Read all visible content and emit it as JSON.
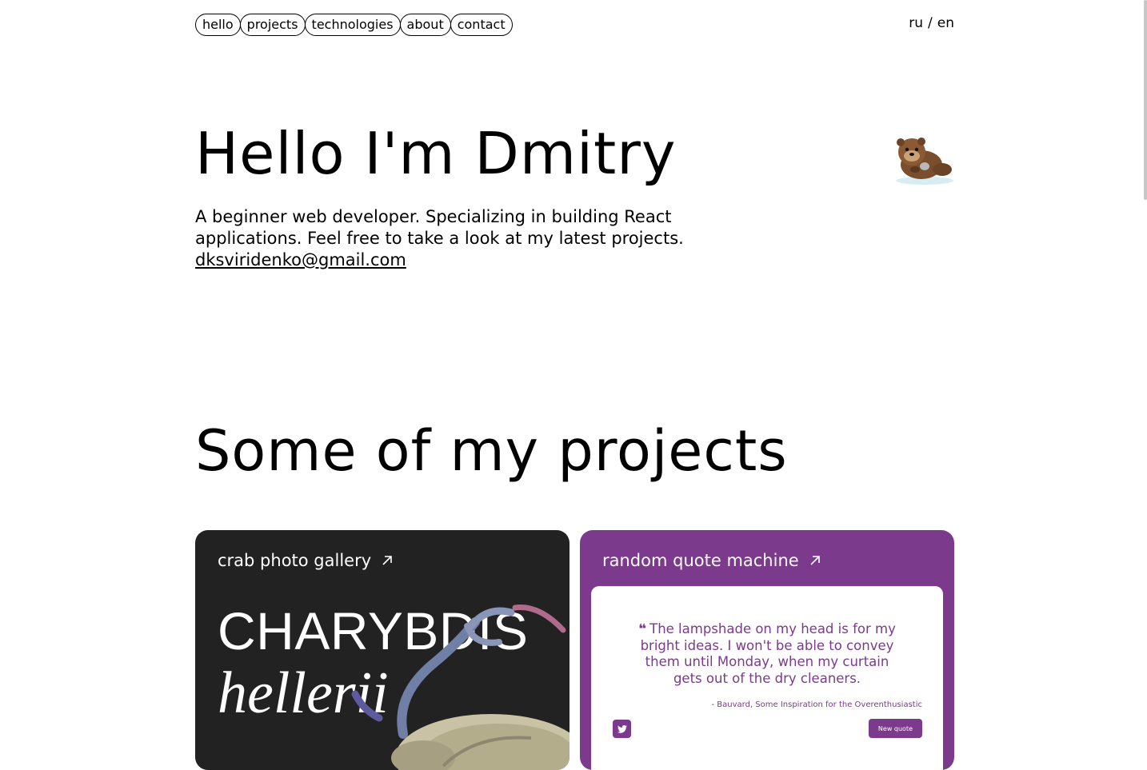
{
  "nav": {
    "items": [
      {
        "label": "hello"
      },
      {
        "label": "projects"
      },
      {
        "label": "technologies"
      },
      {
        "label": "about"
      },
      {
        "label": "contact"
      }
    ]
  },
  "lang": {
    "ru": "ru",
    "separator": "/",
    "en": "en"
  },
  "hero": {
    "title": "Hello I'm Dmitry",
    "description": "A beginner web developer. Specializing in building React applications. Feel free to take a look at my latest projects.",
    "email": "dksviridenko@gmail.com",
    "mascot_icon": "otter-emoji"
  },
  "projects": {
    "title": "Some of my projects",
    "cards": [
      {
        "title": "crab photo gallery",
        "headline": "CHARYBDIS",
        "subheadline": "hellerii",
        "background": "#222222"
      },
      {
        "title": "random quote machine",
        "quote": "The lampshade on my head is for my bright ideas. I won't be able to convey them until Monday, when my curtain gets out of the dry cleaners.",
        "author": "- Bauvard, Some Inspiration for the Overenthusiastic",
        "tweet_icon": "twitter-icon",
        "new_quote_label": "New quote",
        "background": "#7b3a8b"
      }
    ]
  },
  "colors": {
    "accent_purple": "#7b3a8b",
    "dark_card": "#222222"
  }
}
